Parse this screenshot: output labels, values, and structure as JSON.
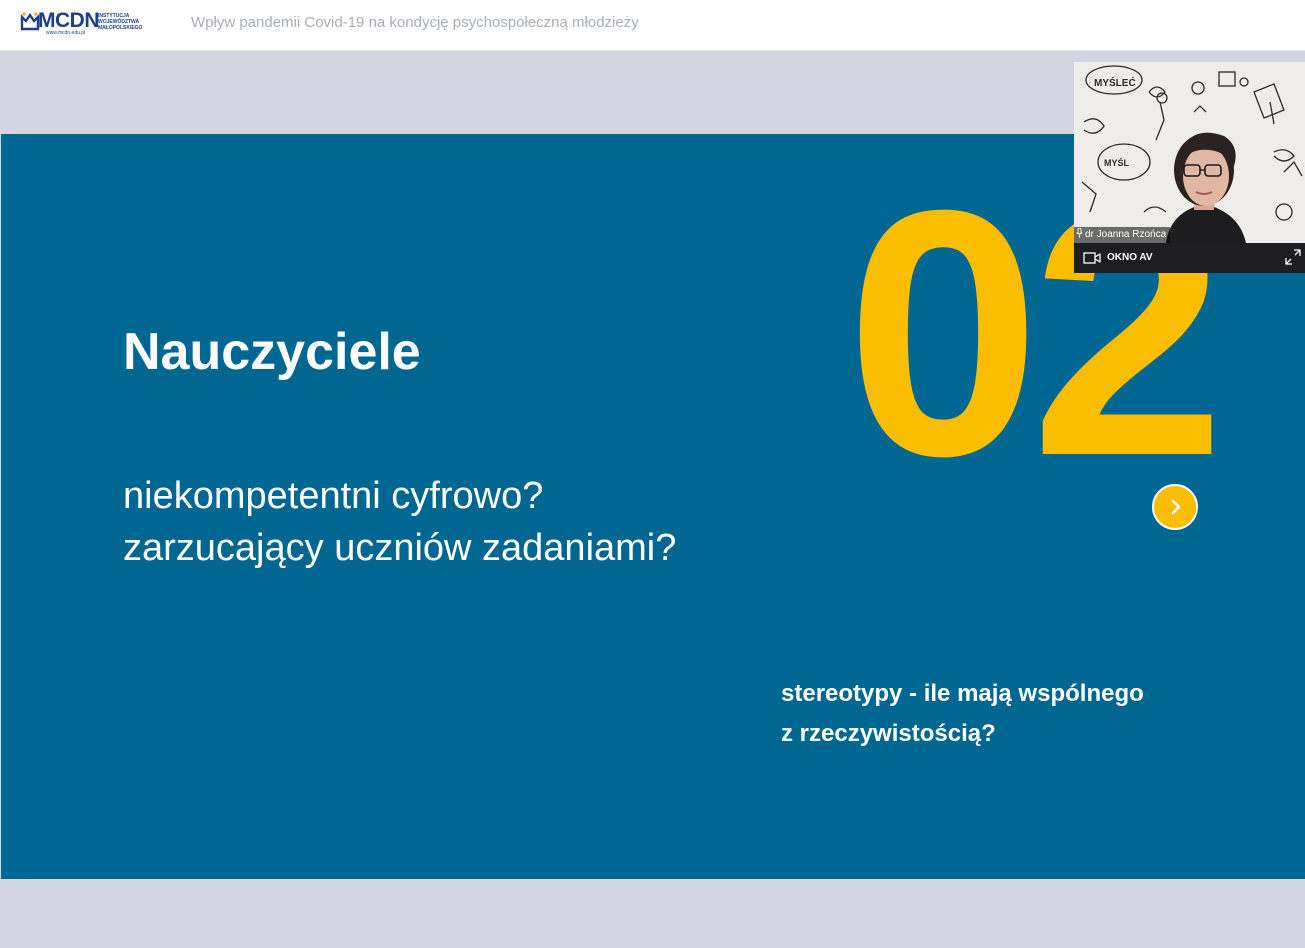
{
  "header": {
    "logo_text": "MCDN",
    "logo_url": "www.mcdn.edu.pl",
    "logo_institution": [
      "INSTYTUCJA",
      "WOJEWÓDZTWA",
      "MAŁOPOLSKIEGO"
    ],
    "document_title": "Wpływ pandemii Covid-19 na kondycję psychospołeczną młodzieży"
  },
  "slide": {
    "number": "02",
    "title": "Nauczyciele",
    "subtitle_lines": [
      "niekompetentni cyfrowo?",
      "zarzucający uczniów zadaniami?"
    ],
    "note_lines": [
      "stereotypy - ile mają wspólnego",
      "z rzeczywistością?"
    ],
    "next_icon": "chevron-right-icon",
    "colors": {
      "background": "#006793",
      "accent": "#fbbd00",
      "text": "#ffffff"
    }
  },
  "av_window": {
    "speaker_name": "dr Joanna Rzońca",
    "label": "OKNO AV",
    "icons": [
      "microphone-icon",
      "camera-icon",
      "expand-icon"
    ]
  }
}
